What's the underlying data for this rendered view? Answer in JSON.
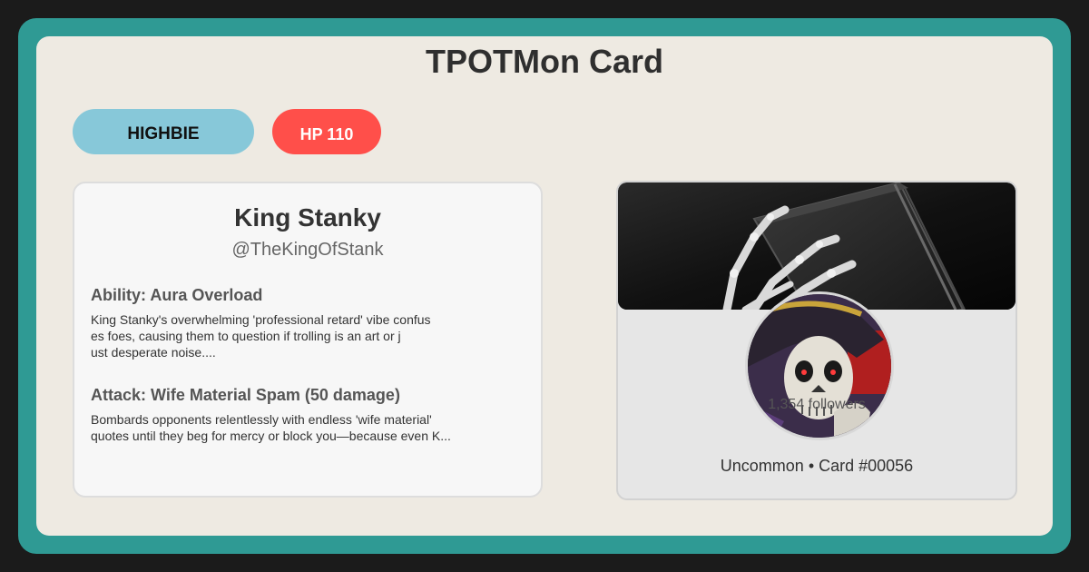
{
  "title": "TPOTMon Card",
  "type_badge": "HIGHBIE",
  "hp_badge": "HP 110",
  "character": {
    "name": "King Stanky",
    "handle": "@TheKingOfStank"
  },
  "ability": {
    "heading": "Ability: Aura Overload",
    "lines": [
      "King Stanky's overwhelming 'professional retard' vibe confus",
      "es foes, causing them to question if trolling is an art or j",
      "ust desperate noise...."
    ]
  },
  "attack": {
    "heading": "Attack: Wife Material Spam (50 damage)",
    "lines": [
      "Bombards opponents relentlessly with endless 'wife material'",
      "quotes until they beg for mercy or block you—because even K..."
    ]
  },
  "profile": {
    "banner_image": "skeleton-hand-on-book-image",
    "avatar_image": "skull-king-avatar-image",
    "followers": "1,354 followers",
    "rarity_line": "Uncommon • Card #00056"
  },
  "colors": {
    "frame": "#2f9a94",
    "card": "#eeeae2",
    "type_badge": "#87c8d9",
    "hp_badge": "#ff4f4a"
  }
}
